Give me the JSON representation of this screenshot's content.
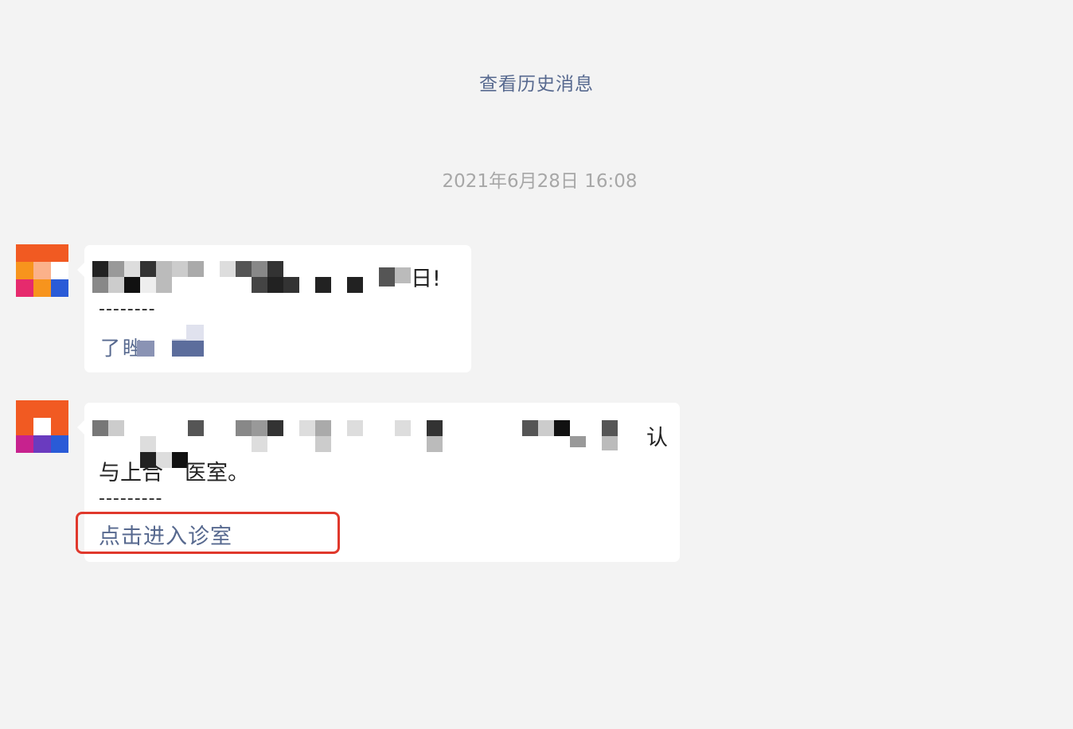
{
  "header": {
    "history_link": "查看历史消息"
  },
  "timestamp": "2021年6月28日 16:08",
  "messages": [
    {
      "visible_fragments": [
        "日!",
        "--------",
        "了",
        "睉"
      ]
    },
    {
      "visible_fragments": [
        "认",
        "与上合",
        "医室。",
        "---------"
      ],
      "link_label": "点击进入诊室"
    }
  ],
  "colors": {
    "background": "#f3f3f3",
    "link": "#57698f",
    "timestamp": "#a7a7a7",
    "highlight": "#e0382c"
  }
}
